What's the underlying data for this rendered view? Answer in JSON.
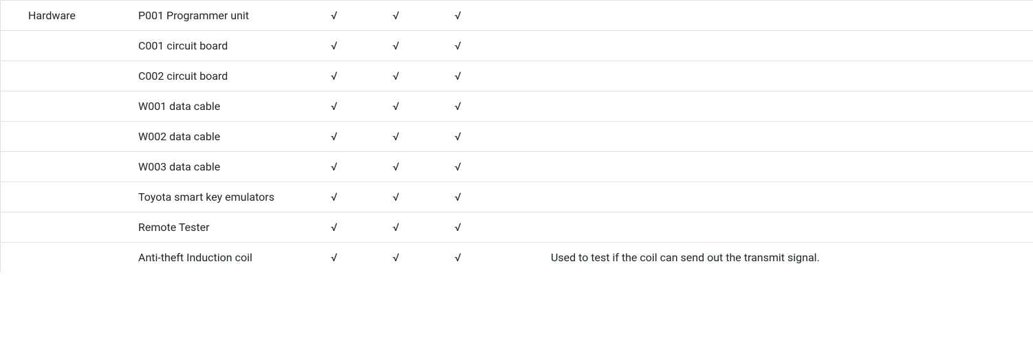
{
  "category": "Hardware",
  "checkmark": "√",
  "rows": [
    {
      "item": "P001 Programmer unit",
      "c1": true,
      "c2": true,
      "c3": true,
      "desc": ""
    },
    {
      "item": "C001 circuit board",
      "c1": true,
      "c2": true,
      "c3": true,
      "desc": ""
    },
    {
      "item": "C002 circuit board",
      "c1": true,
      "c2": true,
      "c3": true,
      "desc": ""
    },
    {
      "item": "W001 data cable",
      "c1": true,
      "c2": true,
      "c3": true,
      "desc": ""
    },
    {
      "item": "W002 data cable",
      "c1": true,
      "c2": true,
      "c3": true,
      "desc": ""
    },
    {
      "item": "W003 data cable",
      "c1": true,
      "c2": true,
      "c3": true,
      "desc": ""
    },
    {
      "item": "Toyota smart key emulators",
      "c1": true,
      "c2": true,
      "c3": true,
      "desc": ""
    },
    {
      "item": "Remote Tester",
      "c1": true,
      "c2": true,
      "c3": true,
      "desc": ""
    },
    {
      "item": "Anti-theft Induction coil",
      "c1": true,
      "c2": true,
      "c3": true,
      "desc": "Used to test if the coil can send out the transmit signal."
    }
  ]
}
